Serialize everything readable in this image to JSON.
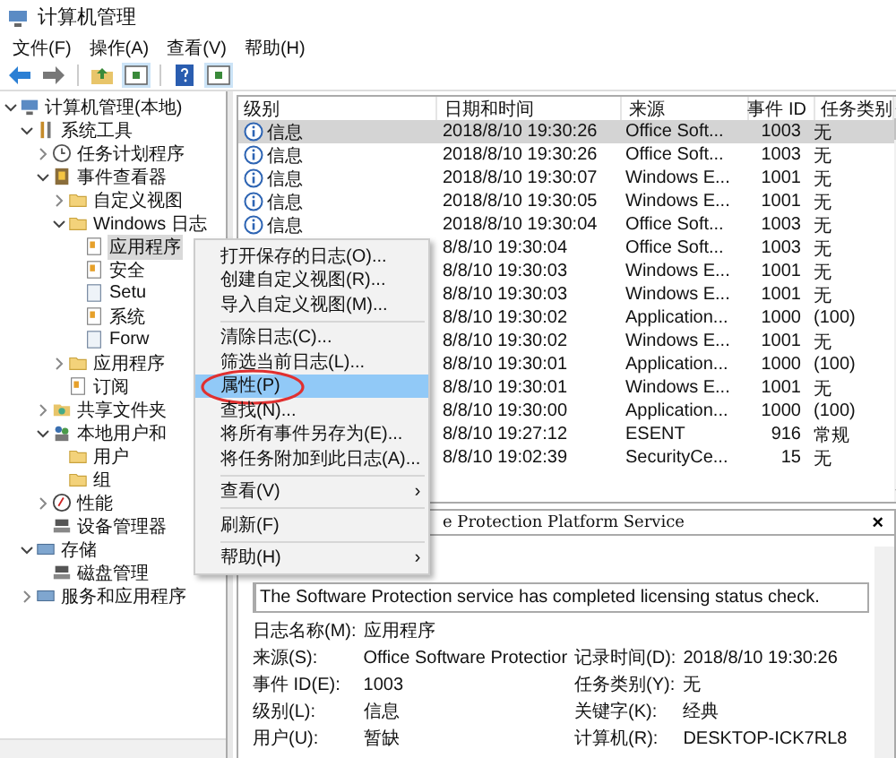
{
  "window": {
    "title": "计算机管理"
  },
  "menu": [
    "文件(F)",
    "操作(A)",
    "查看(V)",
    "帮助(H)"
  ],
  "tree": [
    {
      "label": "计算机管理(本地)",
      "kind": "computer",
      "expanded": true,
      "children": [
        {
          "label": "系统工具",
          "kind": "tool",
          "expanded": true,
          "children": [
            {
              "label": "任务计划程序",
              "kind": "clock",
              "expanded": false
            },
            {
              "label": "事件查看器",
              "kind": "viewer",
              "expanded": true,
              "children": [
                {
                  "label": "自定义视图",
                  "kind": "folder",
                  "expanded": false
                },
                {
                  "label": "Windows 日志",
                  "kind": "folder",
                  "expanded": true,
                  "children": [
                    {
                      "label": "应用程序",
                      "kind": "log",
                      "selected": true
                    },
                    {
                      "label": "安全",
                      "kind": "log",
                      "selected": false
                    },
                    {
                      "label": "Setu",
                      "kind": "page",
                      "selected": false
                    },
                    {
                      "label": "系统",
                      "kind": "log",
                      "selected": false
                    },
                    {
                      "label": "Forw",
                      "kind": "page",
                      "selected": false
                    }
                  ]
                },
                {
                  "label": "应用程序",
                  "kind": "folder",
                  "expanded": false
                },
                {
                  "label": "订阅",
                  "kind": "log"
                }
              ]
            },
            {
              "label": "共享文件夹",
              "kind": "share",
              "expanded": false
            },
            {
              "label": "本地用户和",
              "kind": "users",
              "expanded": true,
              "children": [
                {
                  "label": "用户",
                  "kind": "folder"
                },
                {
                  "label": "组",
                  "kind": "folder"
                }
              ]
            },
            {
              "label": "性能",
              "kind": "perf",
              "expanded": false
            },
            {
              "label": "设备管理器",
              "kind": "device"
            }
          ]
        },
        {
          "label": "存储",
          "kind": "storage",
          "expanded": true,
          "children": [
            {
              "label": "磁盘管理",
              "kind": "device"
            }
          ]
        },
        {
          "label": "服务和应用程序",
          "kind": "storage",
          "expanded": false
        }
      ]
    }
  ],
  "table": {
    "columns": [
      "级别",
      "日期和时间",
      "来源",
      "事件 ID",
      "任务类别"
    ],
    "rows": [
      {
        "level": "信息",
        "datetime": "2018/8/10 19:30:26",
        "source": "Office Soft...",
        "event_id": "1003",
        "task": "无",
        "selected": true
      },
      {
        "level": "信息",
        "datetime": "2018/8/10 19:30:26",
        "source": "Office Soft...",
        "event_id": "1003",
        "task": "无",
        "selected": false
      },
      {
        "level": "信息",
        "datetime": "2018/8/10 19:30:07",
        "source": "Windows E...",
        "event_id": "1001",
        "task": "无",
        "selected": false
      },
      {
        "level": "信息",
        "datetime": "2018/8/10 19:30:05",
        "source": "Windows E...",
        "event_id": "1001",
        "task": "无",
        "selected": false
      },
      {
        "level": "信息",
        "datetime": "2018/8/10 19:30:04",
        "source": "Office Soft...",
        "event_id": "1003",
        "task": "无",
        "selected": false
      },
      {
        "datetime": "8/8/10 19:30:04",
        "source": "Office Soft...",
        "event_id": "1003",
        "task": "无",
        "selected": false
      },
      {
        "datetime": "8/8/10 19:30:03",
        "source": "Windows E...",
        "event_id": "1001",
        "task": "无",
        "selected": false
      },
      {
        "datetime": "8/8/10 19:30:03",
        "source": "Windows E...",
        "event_id": "1001",
        "task": "无",
        "selected": false
      },
      {
        "datetime": "8/8/10 19:30:02",
        "source": "Application...",
        "event_id": "1000",
        "task": "(100)",
        "selected": false
      },
      {
        "datetime": "8/8/10 19:30:02",
        "source": "Windows E...",
        "event_id": "1001",
        "task": "无",
        "selected": false
      },
      {
        "datetime": "8/8/10 19:30:01",
        "source": "Application...",
        "event_id": "1000",
        "task": "(100)",
        "selected": false
      },
      {
        "datetime": "8/8/10 19:30:01",
        "source": "Windows E...",
        "event_id": "1001",
        "task": "无",
        "selected": false
      },
      {
        "datetime": "8/8/10 19:30:00",
        "source": "Application...",
        "event_id": "1000",
        "task": "(100)",
        "selected": false
      },
      {
        "datetime": "8/8/10 19:27:12",
        "source": "ESENT",
        "event_id": "916",
        "task": "常规",
        "selected": false
      },
      {
        "datetime": "8/8/10 19:02:39",
        "source": "SecurityCe...",
        "event_id": "15",
        "task": "无",
        "selected": false
      }
    ]
  },
  "detail": {
    "title": "e Protection Platform Service",
    "close": "×",
    "description": "The Software Protection service has completed licensing status check.",
    "fields": [
      {
        "label": "日志名称(M):",
        "value": "应用程序"
      },
      {
        "label": "来源(S):",
        "value": "Office Software Protectior",
        "label2": "记录时间(D):",
        "value2": "2018/8/10 19:30:26"
      },
      {
        "label": "事件 ID(E):",
        "value": "1003",
        "label2": "任务类别(Y):",
        "value2": "无"
      },
      {
        "label": "级别(L):",
        "value": "信息",
        "label2": "关键字(K):",
        "value2": "经典"
      },
      {
        "label": "用户(U):",
        "value": "暂缺",
        "label2": "计算机(R):",
        "value2": "DESKTOP-ICK7RL8"
      }
    ]
  },
  "context_menu": [
    {
      "kind": "item",
      "label": "打开保存的日志(O)...",
      "selected": false
    },
    {
      "kind": "item",
      "label": "创建自定义视图(R)...",
      "selected": false
    },
    {
      "kind": "item",
      "label": "导入自定义视图(M)...",
      "selected": false
    },
    {
      "kind": "separator"
    },
    {
      "kind": "item",
      "label": "清除日志(C)...",
      "selected": false
    },
    {
      "kind": "item",
      "label": "筛选当前日志(L)...",
      "selected": false
    },
    {
      "kind": "item",
      "label": "属性(P)",
      "selected": true,
      "circled": true
    },
    {
      "kind": "item",
      "label": "查找(N)...",
      "selected": false
    },
    {
      "kind": "item",
      "label": "将所有事件另存为(E)...",
      "selected": false
    },
    {
      "kind": "item",
      "label": "将任务附加到此日志(A)...",
      "selected": false
    },
    {
      "kind": "separator"
    },
    {
      "kind": "submenu",
      "label": "查看(V)",
      "arrow": "›",
      "selected": false
    },
    {
      "kind": "separator"
    },
    {
      "kind": "item",
      "label": "刷新(F)",
      "selected": false
    },
    {
      "kind": "separator"
    },
    {
      "kind": "submenu",
      "label": "帮助(H)",
      "arrow": "›",
      "selected": false
    }
  ]
}
